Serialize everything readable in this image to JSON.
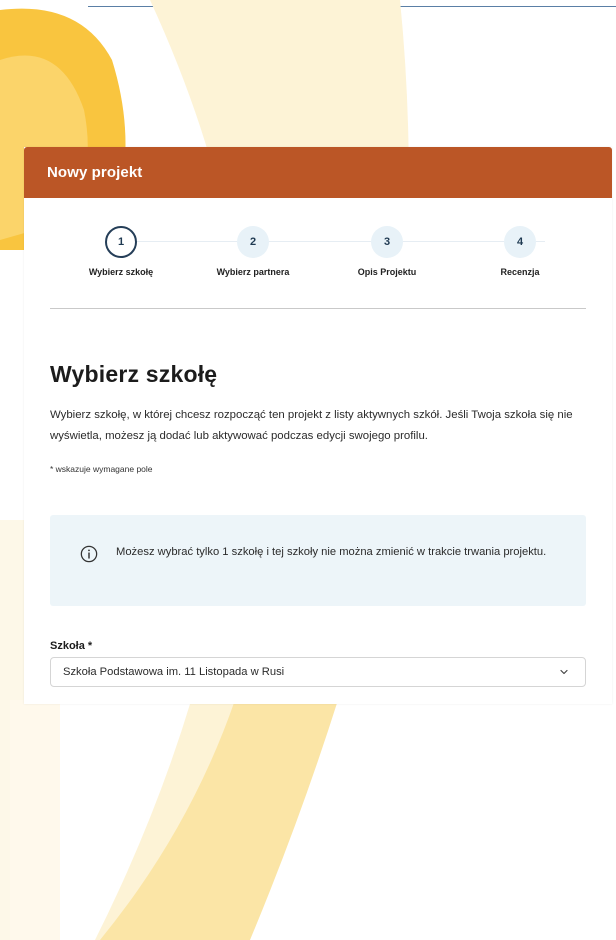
{
  "header": {
    "title": "Nowy projekt"
  },
  "stepper": {
    "steps": [
      {
        "number": "1",
        "label": "Wybierz szkołę",
        "active": true
      },
      {
        "number": "2",
        "label": "Wybierz partnera",
        "active": false
      },
      {
        "number": "3",
        "label": "Opis Projektu",
        "active": false
      },
      {
        "number": "4",
        "label": "Recenzja",
        "active": false
      }
    ]
  },
  "main": {
    "title": "Wybierz szkołę",
    "intro": "Wybierz szkołę, w której chcesz rozpocząć ten projekt z listy aktywnych szkół. Jeśli Twoja szkoła się nie wyświetla, możesz ją dodać lub aktywować podczas edycji swojego profilu.",
    "required_note": "* wskazuje wymagane pole",
    "info": {
      "icon": "info-icon",
      "text": "Możesz wybrać tylko 1 szkołę i tej szkoły nie można zmienić w trakcie trwania projektu."
    },
    "school_field": {
      "label": "Szkoła *",
      "selected": "Szkoła Podstawowa im. 11 Listopada w Rusi",
      "icon": "chevron-down-icon"
    }
  },
  "colors": {
    "header_bg": "#bb5626",
    "accent_dark": "#253e58",
    "info_bg": "#edf5f9",
    "bg_yellow": "#f9c53f",
    "bg_cream": "#fdf3d6"
  }
}
